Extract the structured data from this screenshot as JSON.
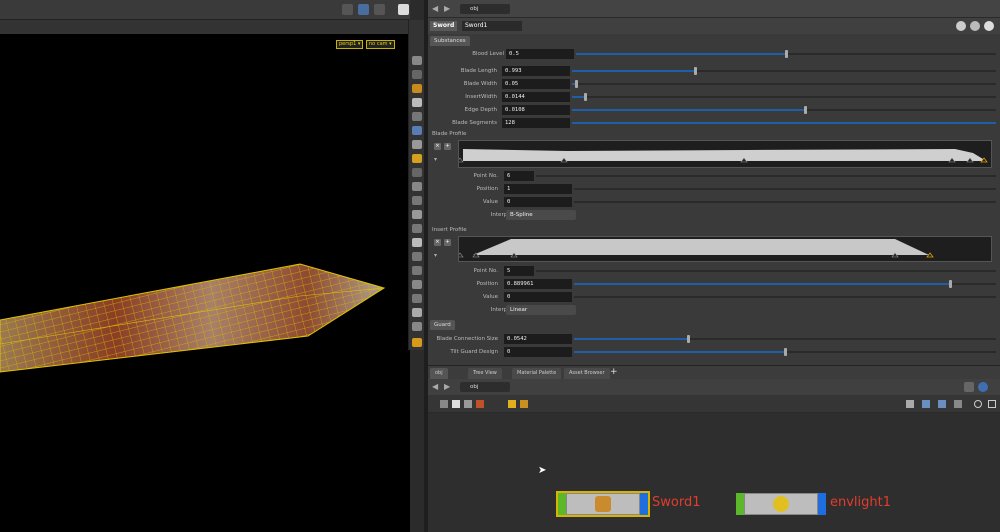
{
  "viewport": {
    "camera_menu": "persp1 ▾",
    "camera_mode": "no cam ▾"
  },
  "params": {
    "path": "obj",
    "node_type": "Sword",
    "node_name": "Sword1",
    "folder_substances": "Substances",
    "blood_level_label": "Blood Level",
    "blood_level_value": "0.5",
    "blood_level_fill": 0.5,
    "blade_length_label": "Blade Length",
    "blade_length_value": "0.993",
    "blade_length_fill": 0.29,
    "blade_width_label": "Blade Width",
    "blade_width_value": "0.05",
    "blade_width_fill": 0.01,
    "insert_width_label": "InsertWidth",
    "insert_width_value": "0.0144",
    "insert_width_fill": 0.03,
    "edge_depth_label": "Edge Depth",
    "edge_depth_value": "0.0108",
    "edge_depth_fill": 0.55,
    "blade_segments_label": "Blade Segments",
    "blade_segments_value": "128",
    "blade_segments_fill": 1.0,
    "blade_profile_label": "Blade Profile",
    "blade_point_no_label": "Point No.",
    "blade_point_no_value": "6",
    "blade_position_label": "Position",
    "blade_position_value": "1",
    "blade_value_label": "Value",
    "blade_value_value": "0",
    "blade_interp_label": "Interpolation",
    "blade_interp_value": "B-Spline",
    "insert_profile_label": "Insert Profile",
    "insert_point_no_label": "Point No.",
    "insert_point_no_value": "5",
    "insert_position_label": "Position",
    "insert_position_value": "0.889961",
    "insert_position_fill": 0.89,
    "insert_value_label": "Value",
    "insert_value_value": "0",
    "insert_interp_label": "Interpolation",
    "insert_interp_value": "Linear",
    "folder_guard": "Guard",
    "blade_conn_label": "Blade Connection Size",
    "blade_conn_value": "0.0542",
    "blade_conn_fill": 0.27,
    "tilt_guard_label": "Tilt Guard Design",
    "tilt_guard_value": "0",
    "tilt_guard_fill": 0.5
  },
  "network": {
    "tabs": [
      "obj",
      "Tree View",
      "Material Palette",
      "Asset Browser"
    ],
    "tab_add": "+",
    "path": "obj",
    "nodes": [
      {
        "name": "Sword1"
      },
      {
        "name": "envlight1"
      }
    ]
  },
  "colors": {
    "accent_blue": "#1f5fa8",
    "node_label_red": "#e23c2c",
    "selection_yellow": "#d8b400",
    "display_flag_blue": "#1e6ee0",
    "bypass_flag_green": "#5cb82a"
  }
}
